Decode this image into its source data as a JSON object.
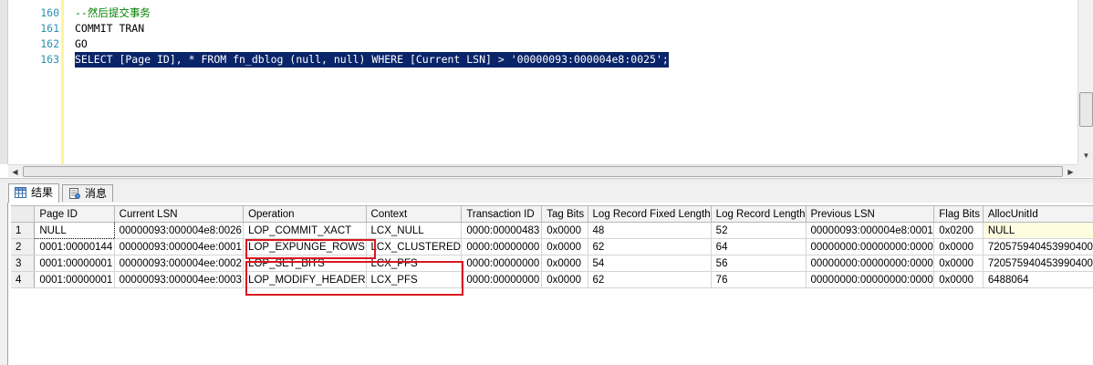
{
  "editor": {
    "lines": [
      {
        "num": "160",
        "text": "--然后提交事务",
        "kind": "comment"
      },
      {
        "num": "161",
        "text": "COMMIT TRAN",
        "kind": "code"
      },
      {
        "num": "162",
        "text": "GO",
        "kind": "code"
      },
      {
        "num": "163",
        "text": "SELECT [Page ID], * FROM fn_dblog (null, null) WHERE [Current LSN] > '00000093:000004e8:0025';",
        "kind": "selected"
      }
    ]
  },
  "tabs": {
    "results_label": "结果",
    "messages_label": "消息",
    "results_icon": "grid-icon",
    "messages_icon": "message-icon"
  },
  "grid": {
    "columns": [
      "Page ID",
      "Current LSN",
      "Operation",
      "Context",
      "Transaction ID",
      "Tag Bits",
      "Log Record Fixed Length",
      "Log Record Length",
      "Previous LSN",
      "Flag Bits",
      "AllocUnitId"
    ],
    "rows": [
      {
        "num": "1",
        "cells": [
          "NULL",
          "00000093:000004e8:0026",
          "LOP_COMMIT_XACT",
          "LCX_NULL",
          "0000:00000483",
          "0x0000",
          "48",
          "52",
          "00000093:000004e8:0001",
          "0x0200",
          "NULL"
        ]
      },
      {
        "num": "2",
        "cells": [
          "0001:00000144",
          "00000093:000004ee:0001",
          "LOP_EXPUNGE_ROWS",
          "LCX_CLUSTERED",
          "0000:00000000",
          "0x0000",
          "62",
          "64",
          "00000000:00000000:0000",
          "0x0000",
          "720575940453990400"
        ]
      },
      {
        "num": "3",
        "cells": [
          "0001:00000001",
          "00000093:000004ee:0002",
          "LOP_SET_BITS",
          "LCX_PFS",
          "0000:00000000",
          "0x0000",
          "54",
          "56",
          "00000000:00000000:0000",
          "0x0000",
          "720575940453990400"
        ]
      },
      {
        "num": "4",
        "cells": [
          "0001:00000001",
          "00000093:000004ee:0003",
          "LOP_MODIFY_HEADER",
          "LCX_PFS",
          "0000:00000000",
          "0x0000",
          "62",
          "76",
          "00000000:00000000:0000",
          "0x0000",
          "6488064"
        ]
      }
    ]
  },
  "colors": {
    "selection": "#0a246a",
    "comment": "#008000",
    "line_number": "#2b91af",
    "highlight_box": "#d81820"
  }
}
